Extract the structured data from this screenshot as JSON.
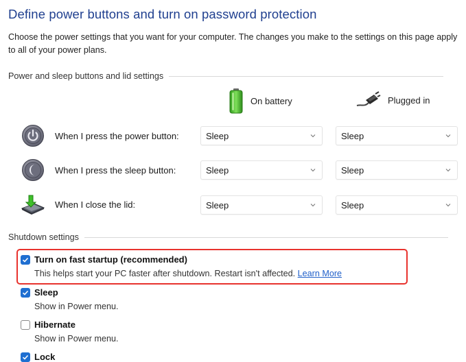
{
  "page": {
    "title": "Define power buttons and turn on password protection",
    "description": "Choose the power settings that you want for your computer. The changes you make to the settings on this page apply to all of your power plans."
  },
  "buttons_section": {
    "header": "Power and sleep buttons and lid settings",
    "col_battery": "On battery",
    "col_plugged": "Plugged in",
    "rows": [
      {
        "label": "When I press the power button:",
        "icon": "power-button-icon",
        "battery": "Sleep",
        "plugged": "Sleep"
      },
      {
        "label": "When I press the sleep button:",
        "icon": "sleep-button-icon",
        "battery": "Sleep",
        "plugged": "Sleep"
      },
      {
        "label": "When I close the lid:",
        "icon": "laptop-lid-icon",
        "battery": "Sleep",
        "plugged": "Sleep"
      }
    ]
  },
  "shutdown_section": {
    "header": "Shutdown settings",
    "items": [
      {
        "label": "Turn on fast startup (recommended)",
        "checked": true,
        "sub": "This helps start your PC faster after shutdown. Restart isn't affected.",
        "link": "Learn More"
      },
      {
        "label": "Sleep",
        "checked": true,
        "sub": "Show in Power menu."
      },
      {
        "label": "Hibernate",
        "checked": false,
        "sub": "Show in Power menu."
      },
      {
        "label": "Lock",
        "checked": true
      }
    ]
  },
  "colors": {
    "title": "#1f3f8f",
    "checkbox_accent": "#1f6fd1",
    "link": "#1f5fc9",
    "highlight_box": "#e8322d"
  }
}
